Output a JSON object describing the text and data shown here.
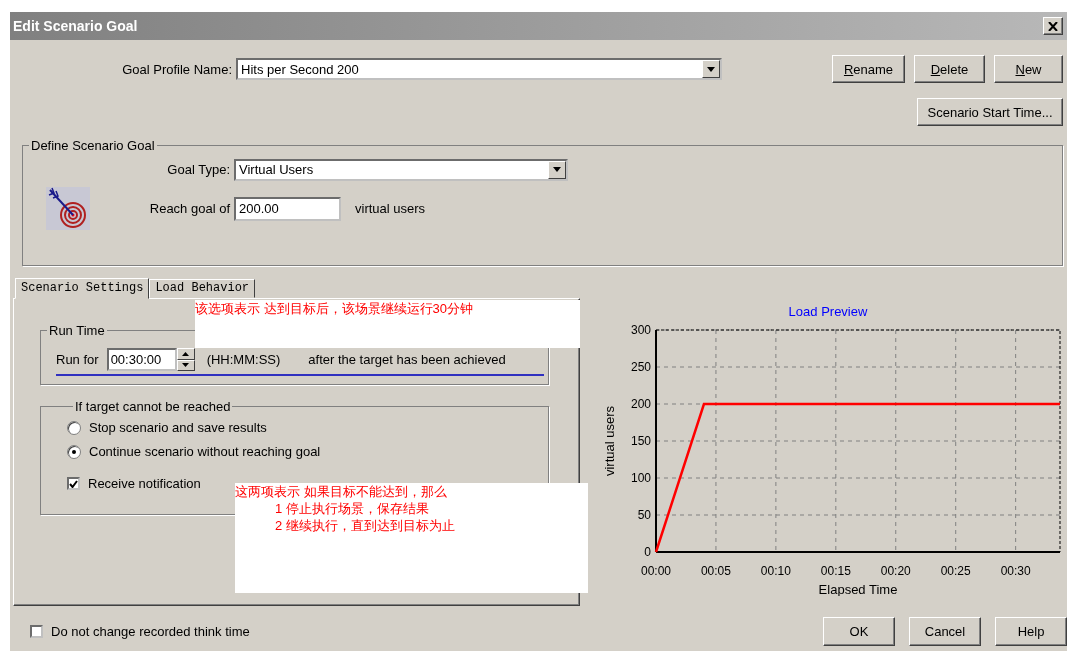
{
  "window": {
    "title": "Edit Scenario Goal"
  },
  "goal_profile": {
    "label": "Goal Profile Name:",
    "value": "Hits per Second 200"
  },
  "profile_buttons": [
    {
      "label": "Rename"
    },
    {
      "label": "Delete"
    },
    {
      "label": "New"
    }
  ],
  "start_time_button": "Scenario Start Time...",
  "define_goal": {
    "title": "Define Scenario Goal",
    "goal_type_label": "Goal Type:",
    "goal_type": "Virtual Users",
    "reach_label": "Reach goal of",
    "reach_value": "200.00",
    "reach_unit": "virtual users"
  },
  "tabs": [
    {
      "label": "Scenario Settings",
      "selected": true
    },
    {
      "label": "Load Behavior",
      "selected": false
    }
  ],
  "run_time": {
    "title": "Run Time",
    "label": "Run for",
    "value": "00:30:00",
    "format": "(HH:MM:SS)",
    "suffix": "after the target has been achieved"
  },
  "if_unreachable": {
    "title": "If target cannot be reached",
    "options": [
      {
        "label": "Stop scenario and save results",
        "selected": false
      },
      {
        "label": "Continue scenario without reaching goal",
        "selected": true
      }
    ],
    "notification": {
      "label": "Receive notification",
      "checked": true
    }
  },
  "load_preview": {
    "chart_data": {
      "type": "line",
      "title": "Load Preview",
      "xlabel": "Elapsed Time",
      "ylabel": "virtual users",
      "xlim": [
        0,
        33.7
      ],
      "ylim": [
        0,
        300
      ],
      "xticks": [
        {
          "value": 0,
          "label": "00:00"
        },
        {
          "value": 5,
          "label": "00:05"
        },
        {
          "value": 10,
          "label": "00:10"
        },
        {
          "value": 15,
          "label": "00:15"
        },
        {
          "value": 20,
          "label": "00:20"
        },
        {
          "value": 25,
          "label": "00:25"
        },
        {
          "value": 30,
          "label": "00:30"
        }
      ],
      "yticks": [
        0,
        50,
        100,
        150,
        200,
        250,
        300
      ],
      "grid": true,
      "x": [
        0,
        4,
        33.7
      ],
      "series": [
        {
          "color": "#ff0000",
          "values": [
            0,
            200,
            200
          ]
        }
      ]
    }
  },
  "think_time": {
    "label": "Do not change recorded think time",
    "checked": false
  },
  "dialog_buttons": [
    "OK",
    "Cancel",
    "Help"
  ],
  "annotations": [
    {
      "lines": [
        "该选项表示  达到目标后，该场景继续运行30分钟"
      ]
    },
    {
      "lines": [
        "这两项表示  如果目标不能达到，那么",
        "1  停止执行场景，保存结果",
        "2  继续执行，直到达到目标为止"
      ]
    }
  ]
}
